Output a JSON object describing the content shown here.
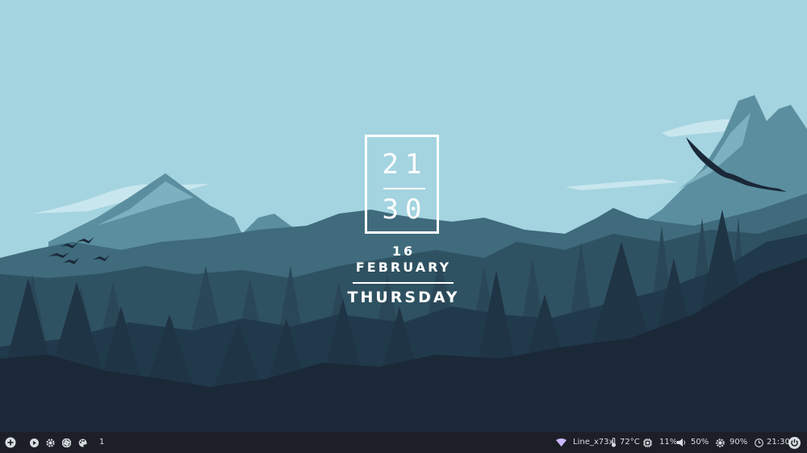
{
  "clock": {
    "hours": "21",
    "minutes": "30"
  },
  "date": {
    "day": "16",
    "month": "FEBRUARY",
    "weekday": "THURSDAY"
  },
  "panel": {
    "left": {
      "add_icon": "plus-circle-icon",
      "play_icon": "play-icon",
      "settings_icon": "gear-icon",
      "apps_icon": "shutter-icon",
      "palette_icon": "palette-icon",
      "workspace": "1"
    },
    "right": {
      "wifi": {
        "icon": "wifi-icon",
        "label": "Line_x73x"
      },
      "temperature": {
        "icon": "thermometer-icon",
        "label": "72°C"
      },
      "cpu": {
        "icon": "cpu-icon",
        "label": "11%"
      },
      "volume": {
        "icon": "speaker-icon",
        "label": "50%"
      },
      "brightness": {
        "icon": "sun-gear-icon",
        "label": "90%"
      },
      "time": {
        "icon": "clock-icon",
        "label": "21:30"
      },
      "power_icon": "power-icon"
    }
  },
  "colors": {
    "sky": "#a4d4e0",
    "panel_bg": "#1c1f26",
    "foreground_dark": "#1a2838",
    "mountain_light": "#5b8fa0"
  }
}
